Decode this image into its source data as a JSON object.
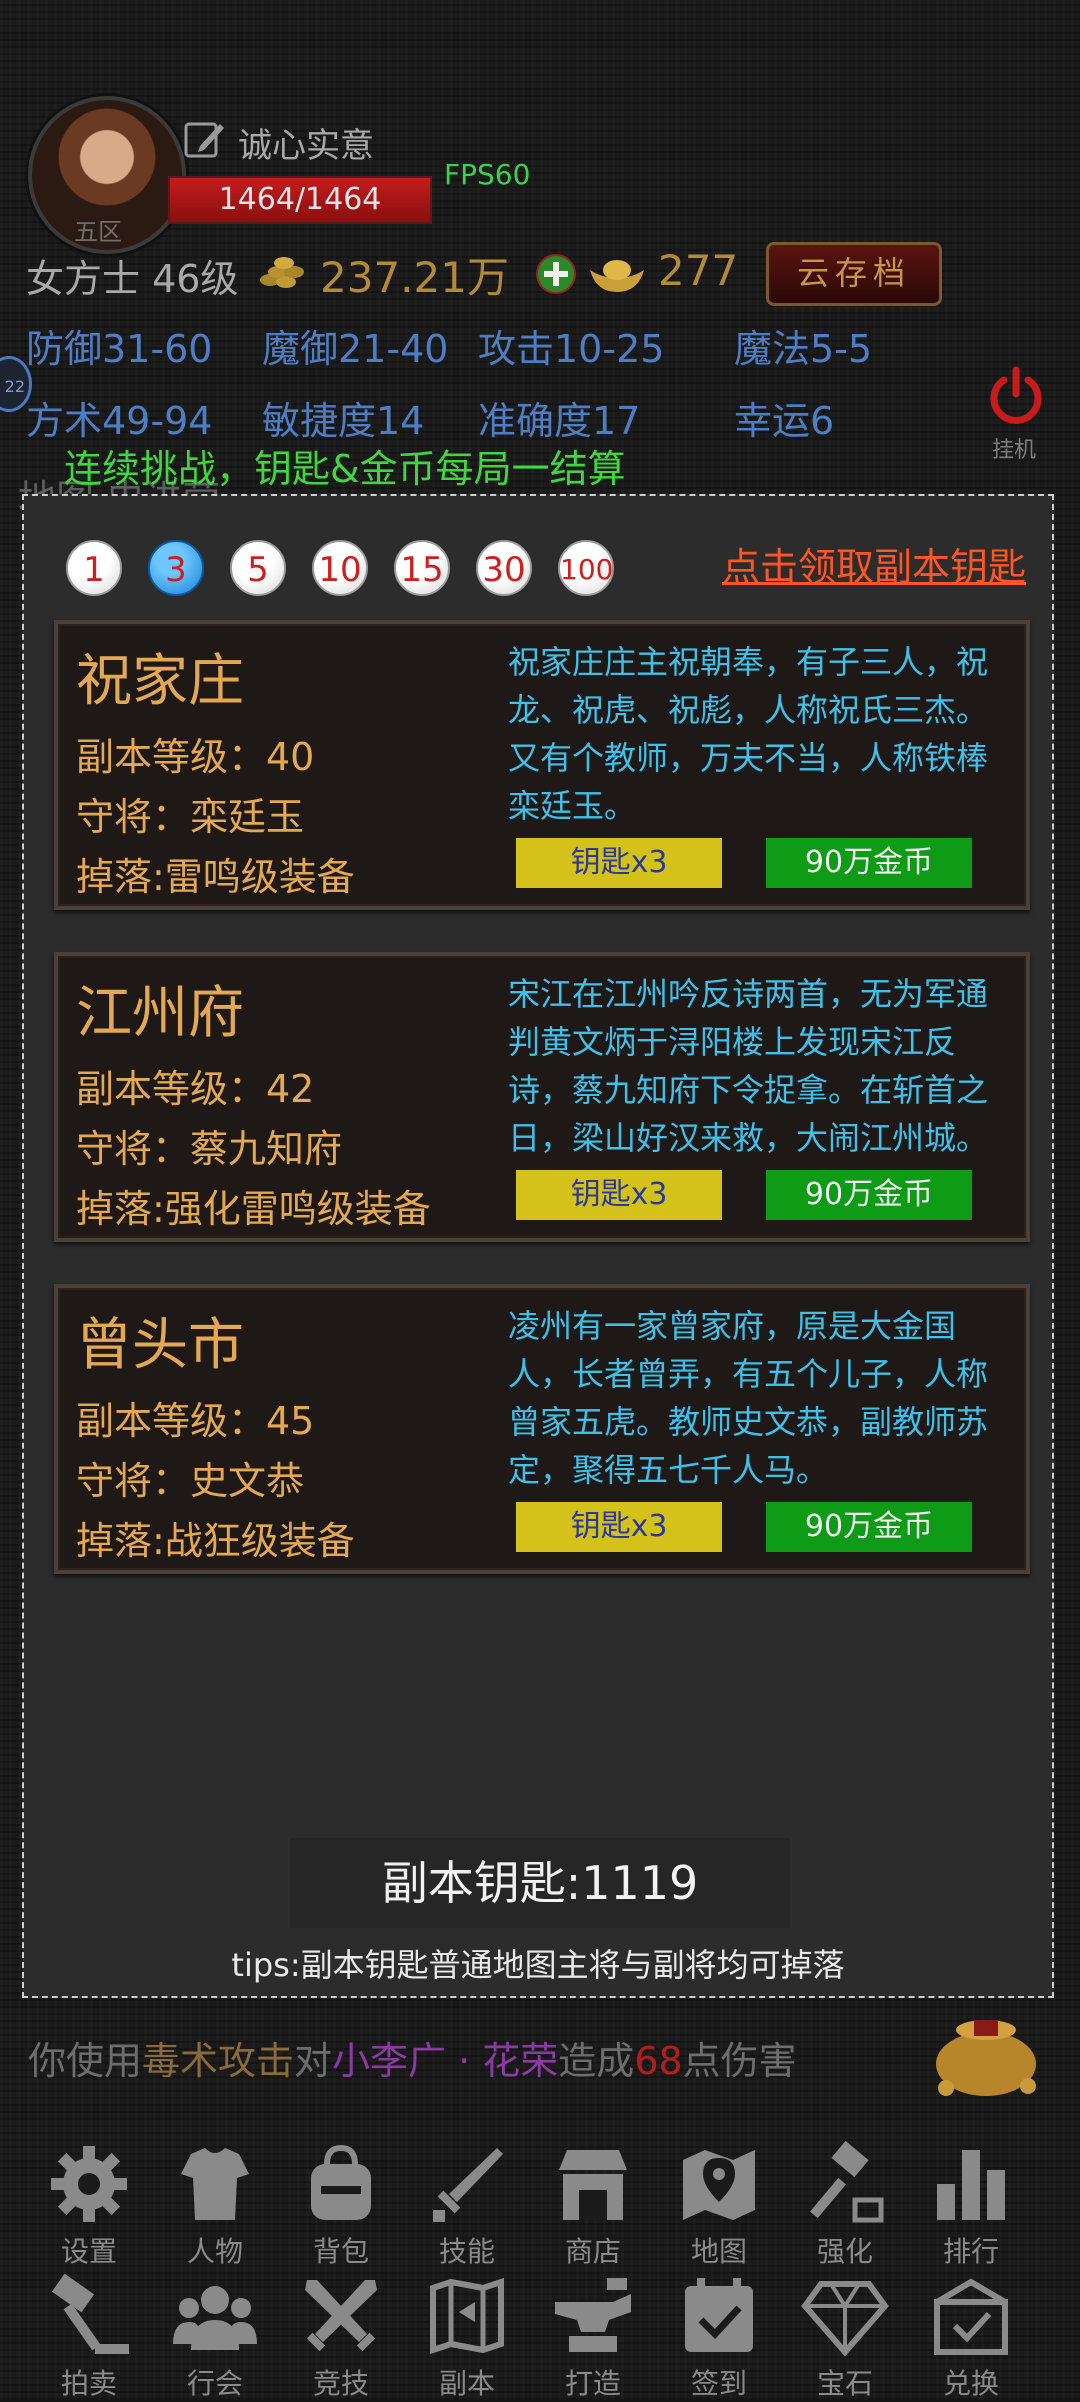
{
  "header": {
    "player_name": "诚心实意",
    "server": "五区",
    "hp": "1464/1464",
    "fps": "FPS60",
    "class_level": "女方士 46级",
    "gold": "237.21万",
    "ingot": "277",
    "cloud_save": "云存档",
    "afk": "挂机",
    "side_badge": "22"
  },
  "stats": [
    {
      "label": "防御31-60"
    },
    {
      "label": "魔御21-40"
    },
    {
      "label": "攻击10-25"
    },
    {
      "label": "魔法5-5"
    },
    {
      "label": "方术49-94"
    },
    {
      "label": "敏捷度14"
    },
    {
      "label": "准确度17"
    },
    {
      "label": "幸运6"
    }
  ],
  "notice": "连续挑战，钥匙&金币每局一结算",
  "ghost_text": "地图·史进营",
  "panel": {
    "multipliers": [
      "1",
      "3",
      "5",
      "10",
      "15",
      "30",
      "100"
    ],
    "selected_multiplier": "3",
    "claim_link": "点击领取副本钥匙",
    "dungeons": [
      {
        "name": "祝家庄",
        "level": "副本等级：40",
        "boss": "守将：栾廷玉",
        "drop": "掉落:雷鸣级装备",
        "desc": "祝家庄庄主祝朝奉，有子三人，祝龙、祝虎、祝彪，人称祝氏三杰。又有个教师，万夫不当，人称铁棒栾廷玉。",
        "key_button": "钥匙x3",
        "gold_button": "90万金币"
      },
      {
        "name": "江州府",
        "level": "副本等级：42",
        "boss": "守将：蔡九知府",
        "drop": "掉落:强化雷鸣级装备",
        "desc": "宋江在江州吟反诗两首，无为军通判黄文炳于浔阳楼上发现宋江反诗，蔡九知府下令捉拿。在斩首之日，梁山好汉来救，大闹江州城。",
        "key_button": "钥匙x3",
        "gold_button": "90万金币"
      },
      {
        "name": "曾头市",
        "level": "副本等级：45",
        "boss": "守将：史文恭",
        "drop": "掉落:战狂级装备",
        "desc": "凌州有一家曾家府，原是大金国人，长者曾弄，有五个儿子，人称曾家五虎。教师史文恭，副教师苏定，聚得五七千人马。",
        "key_button": "钥匙x3",
        "gold_button": "90万金币"
      }
    ],
    "key_count": "副本钥匙:1119",
    "tips": "tips:副本钥匙普通地图主将与副将均可掉落"
  },
  "combat_log": {
    "prefix": "你使用",
    "skill": "毒术攻击",
    "mid": "对",
    "target": "小李广 · 花荣",
    "mid2": "造成",
    "damage": "68",
    "suffix": "点伤害"
  },
  "nav": {
    "row1": [
      {
        "label": "设置",
        "icon": "gear-icon"
      },
      {
        "label": "人物",
        "icon": "armor-icon"
      },
      {
        "label": "背包",
        "icon": "backpack-icon"
      },
      {
        "label": "技能",
        "icon": "sword-icon"
      },
      {
        "label": "商店",
        "icon": "shop-icon"
      },
      {
        "label": "地图",
        "icon": "map-pin-icon"
      },
      {
        "label": "强化",
        "icon": "hammer-upgrade-icon"
      },
      {
        "label": "排行",
        "icon": "bar-chart-icon"
      }
    ],
    "row2": [
      {
        "label": "拍卖",
        "icon": "auction-hammer-icon"
      },
      {
        "label": "行会",
        "icon": "group-icon"
      },
      {
        "label": "竞技",
        "icon": "crossed-swords-icon"
      },
      {
        "label": "副本",
        "icon": "dungeon-map-icon"
      },
      {
        "label": "打造",
        "icon": "anvil-icon"
      },
      {
        "label": "签到",
        "icon": "calendar-check-icon"
      },
      {
        "label": "宝石",
        "icon": "gem-icon"
      },
      {
        "label": "兑换",
        "icon": "gift-exchange-icon"
      }
    ]
  },
  "colors": {
    "title_gold": "#e4a950",
    "desc_cyan": "#3fc0e8",
    "key_button_yellow": "#d4c21a",
    "gold_button_green": "#0e9c16",
    "notice_green": "#3fd63f",
    "stat_blue": "#4d7ec4",
    "claim_link_orange": "#ff5522"
  }
}
